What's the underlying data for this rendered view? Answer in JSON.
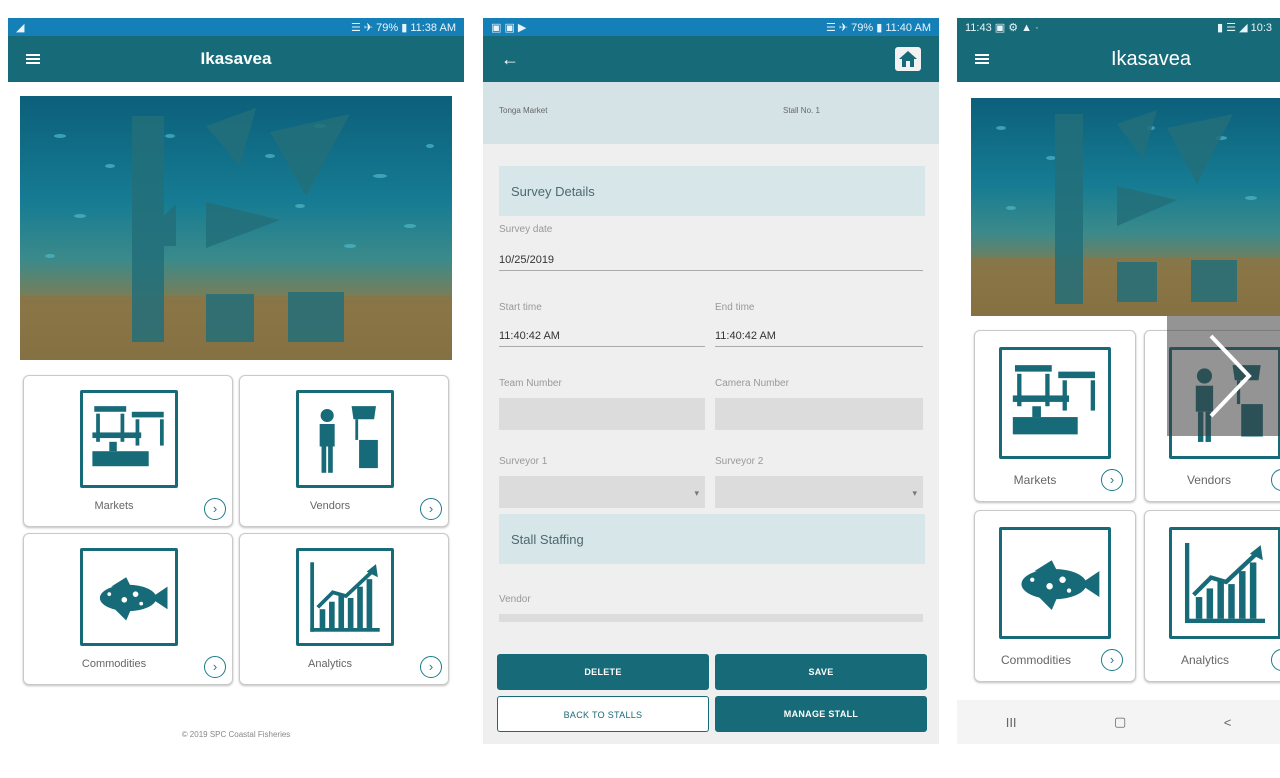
{
  "phone1": {
    "status": {
      "left": "◢",
      "right": "☰ ✈ 79% ▮ 11:38 AM"
    },
    "title": "Ikasavea",
    "tiles": [
      {
        "label": "Markets"
      },
      {
        "label": "Vendors"
      },
      {
        "label": "Commodities"
      },
      {
        "label": "Analytics"
      }
    ],
    "footer": "© 2019 SPC Coastal Fisheries"
  },
  "phone2": {
    "status": {
      "left": "▣ ▣ ▶",
      "right": "☰ ✈ 79% ▮ 11:40 AM"
    },
    "header": {
      "market": "Tonga Market",
      "stall": "Stall No. 1"
    },
    "sections": {
      "survey_details": "Survey Details",
      "stall_staffing": "Stall Staffing"
    },
    "fields": {
      "survey_date_label": "Survey date",
      "survey_date": "10/25/2019",
      "start_time_label": "Start time",
      "start_time": "11:40:42 AM",
      "end_time_label": "End time",
      "end_time": "11:40:42 AM",
      "team_number_label": "Team Number",
      "camera_number_label": "Camera Number",
      "surveyor1_label": "Surveyor 1",
      "surveyor2_label": "Surveyor 2",
      "vendor_label": "Vendor"
    },
    "buttons": {
      "delete": "DELETE",
      "save": "SAVE",
      "back": "BACK TO STALLS",
      "manage": "MANAGE STALL"
    }
  },
  "phone3": {
    "status": {
      "left": "11:43 ▣ ⚙ ▲ ·",
      "right": "▮ ☰ ◢ 10:3"
    },
    "title": "Ikasavea",
    "tiles": [
      {
        "label": "Markets"
      },
      {
        "label": "Vendors"
      },
      {
        "label": "Commodities"
      },
      {
        "label": "Analytics"
      }
    ],
    "nav": {
      "recents": "III",
      "home": "▢",
      "back": "<"
    }
  },
  "colors": {
    "primary": "#176b78",
    "status_blue": "#1580b8",
    "panel": "#d6e6e9"
  },
  "icons": {
    "menu": "menu-icon",
    "home": "home-icon",
    "back": "back-arrow-icon",
    "markets": "market-stalls-icon",
    "vendors": "vendor-icon",
    "commodities": "fish-icon",
    "analytics": "bar-chart-icon",
    "chevron": "chevron-right-icon"
  }
}
